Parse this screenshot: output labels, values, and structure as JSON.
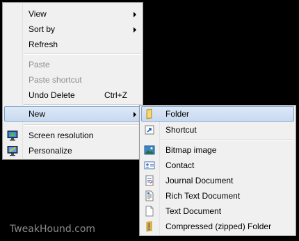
{
  "context_menu": {
    "view_label": "View",
    "sort_by_label": "Sort by",
    "refresh_label": "Refresh",
    "paste_label": "Paste",
    "paste_shortcut_label": "Paste shortcut",
    "undo_delete_label": "Undo Delete",
    "undo_delete_shortcut": "Ctrl+Z",
    "new_label": "New",
    "screen_resolution_label": "Screen resolution",
    "personalize_label": "Personalize"
  },
  "new_submenu": {
    "folder_label": "Folder",
    "shortcut_label": "Shortcut",
    "bitmap_label": "Bitmap image",
    "contact_label": "Contact",
    "journal_label": "Journal Document",
    "rich_text_label": "Rich Text Document",
    "text_document_label": "Text Document",
    "compressed_folder_label": "Compressed (zipped) Folder"
  },
  "watermark": "TweakHound.com",
  "colors": {
    "background": "#000000",
    "menu_bg": "#f0f0f0",
    "highlight_border": "#7da2ce",
    "disabled_text": "#8d8d8d"
  },
  "icons": {
    "screen_resolution": "monitor-icon",
    "personalize": "personalize-icon",
    "folder": "folder-icon",
    "shortcut": "shortcut-icon",
    "bitmap": "bitmap-icon",
    "contact": "contact-icon",
    "journal": "journal-icon",
    "rich_text": "rich-text-icon",
    "text_document": "text-document-icon",
    "compressed_folder": "zip-folder-icon"
  }
}
